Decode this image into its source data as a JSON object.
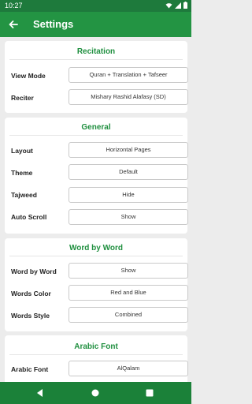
{
  "status": {
    "time": "10:27"
  },
  "appbar": {
    "title": "Settings"
  },
  "sections": {
    "recitation": {
      "title": "Recitation",
      "view_mode_label": "View Mode",
      "view_mode_value": "Quran + Translation + Tafseer",
      "reciter_label": "Reciter",
      "reciter_value": "Mishary Rashid Alafasy (SD)"
    },
    "general": {
      "title": "General",
      "layout_label": "Layout",
      "layout_value": "Horizontal Pages",
      "theme_label": "Theme",
      "theme_value": "Default",
      "tajweed_label": "Tajweed",
      "tajweed_value": "Hide",
      "auto_scroll_label": "Auto Scroll",
      "auto_scroll_value": "Show"
    },
    "word_by_word": {
      "title": "Word by Word",
      "wbw_label": "Word by Word",
      "wbw_value": "Show",
      "words_color_label": "Words Color",
      "words_color_value": "Red and Blue",
      "words_style_label": "Words Style",
      "words_style_value": "Combined"
    },
    "arabic_font": {
      "title": "Arabic Font",
      "font_label": "Arabic Font",
      "font_value": "AlQalam"
    }
  },
  "colors": {
    "accent": "#1f8f3f",
    "appbar": "#239443",
    "statusbar": "#1e7a3c"
  },
  "icons": [
    "back-arrow-icon",
    "wifi-icon",
    "signal-icon",
    "battery-icon",
    "nav-back-icon",
    "nav-home-icon",
    "nav-recents-icon"
  ]
}
